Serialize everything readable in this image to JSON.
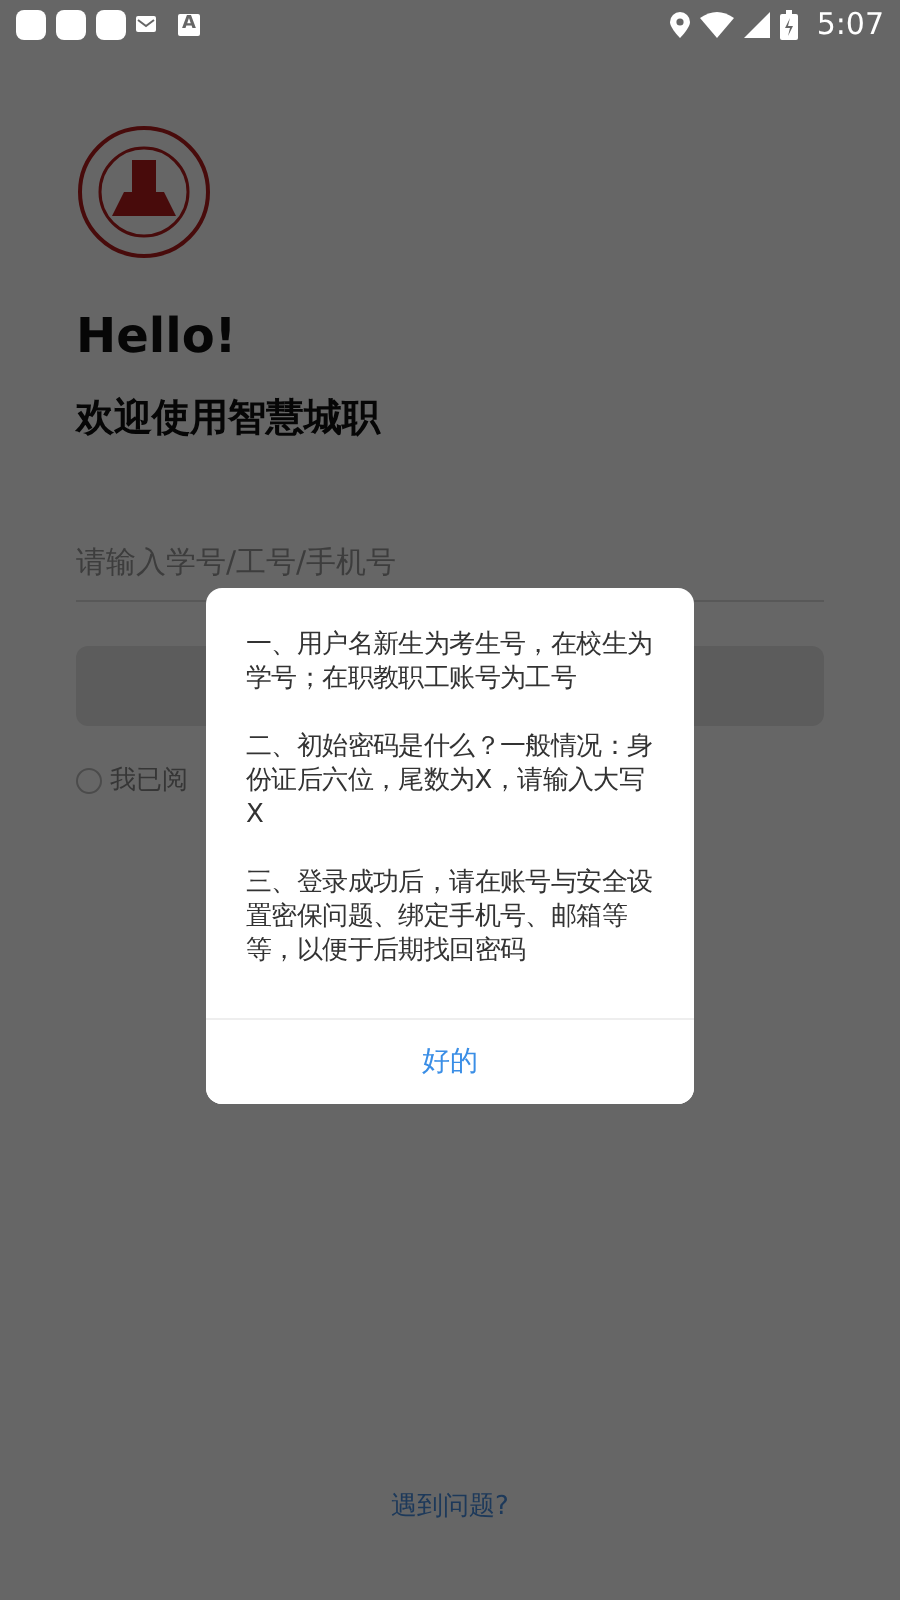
{
  "status_bar": {
    "notification_letter": "A",
    "time": "5:07"
  },
  "login": {
    "greeting": "Hello!",
    "welcome": "欢迎使用智慧城职",
    "username": {
      "placeholder": "请输入学号/工号/手机号"
    },
    "agreement": {
      "checked": false,
      "label": "我已阅"
    },
    "help_link": "遇到问题?"
  },
  "dialog": {
    "paragraphs": [
      "一、用户名新生为考生号，在校生为学号；在职教职工账号为工号",
      "二、初始密码是什么？一般情况：身份证后六位，尾数为X，请输入大写X",
      "三、登录成功后，请在账号与安全设置密保问题、绑定手机号、邮箱等等，以便于后期找回密码"
    ],
    "button": "好的"
  }
}
